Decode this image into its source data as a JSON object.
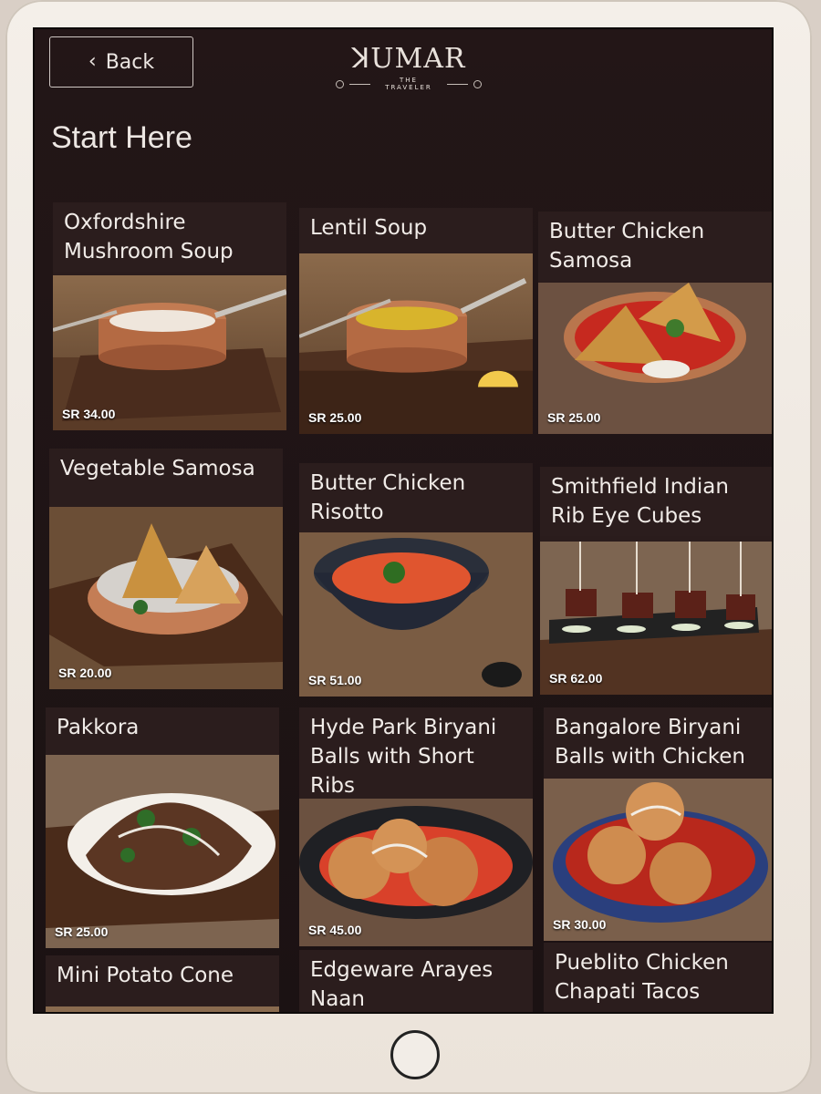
{
  "header": {
    "back_label": "Back",
    "brand_name": "ꓘUMAR",
    "brand_tagline": "THE TRAVELER"
  },
  "section_title": "Start Here",
  "menu": [
    {
      "name": "Oxfordshire Mushroom Soup",
      "price": "SR 34.00",
      "dish": "soup-white"
    },
    {
      "name": "Lentil Soup",
      "price": "SR 25.00",
      "dish": "soup-yellow"
    },
    {
      "name": "Butter Chicken Samosa",
      "price": "SR 25.00",
      "dish": "samosa-red"
    },
    {
      "name": "Vegetable Samosa",
      "price": "SR 20.00",
      "dish": "samosa-copper"
    },
    {
      "name": "Butter Chicken Risotto",
      "price": "SR 51.00",
      "dish": "risotto"
    },
    {
      "name": "Smithfield Indian Rib Eye Cubes",
      "price": "SR 62.00",
      "dish": "skewers"
    },
    {
      "name": "Pakkora",
      "price": "SR 25.00",
      "dish": "pakkora"
    },
    {
      "name": "Hyde Park Biryani Balls with Short Ribs",
      "price": "SR 45.00",
      "dish": "balls-black"
    },
    {
      "name": "Bangalore Biryani Balls with Chicken",
      "price": "SR 30.00",
      "dish": "balls-blue"
    },
    {
      "name": "Mini Potato Cone",
      "price": "",
      "dish": "partial"
    },
    {
      "name": "Edgeware Arayes Naan",
      "price": "",
      "dish": "partial"
    },
    {
      "name": "Pueblito Chicken Chapati Tacos",
      "price": "",
      "dish": "partial"
    }
  ],
  "colors": {
    "screen_bg": "#1e1415",
    "card_bg": "#2a1c1c",
    "text": "#f1ece8",
    "copper": "#c27b52"
  }
}
